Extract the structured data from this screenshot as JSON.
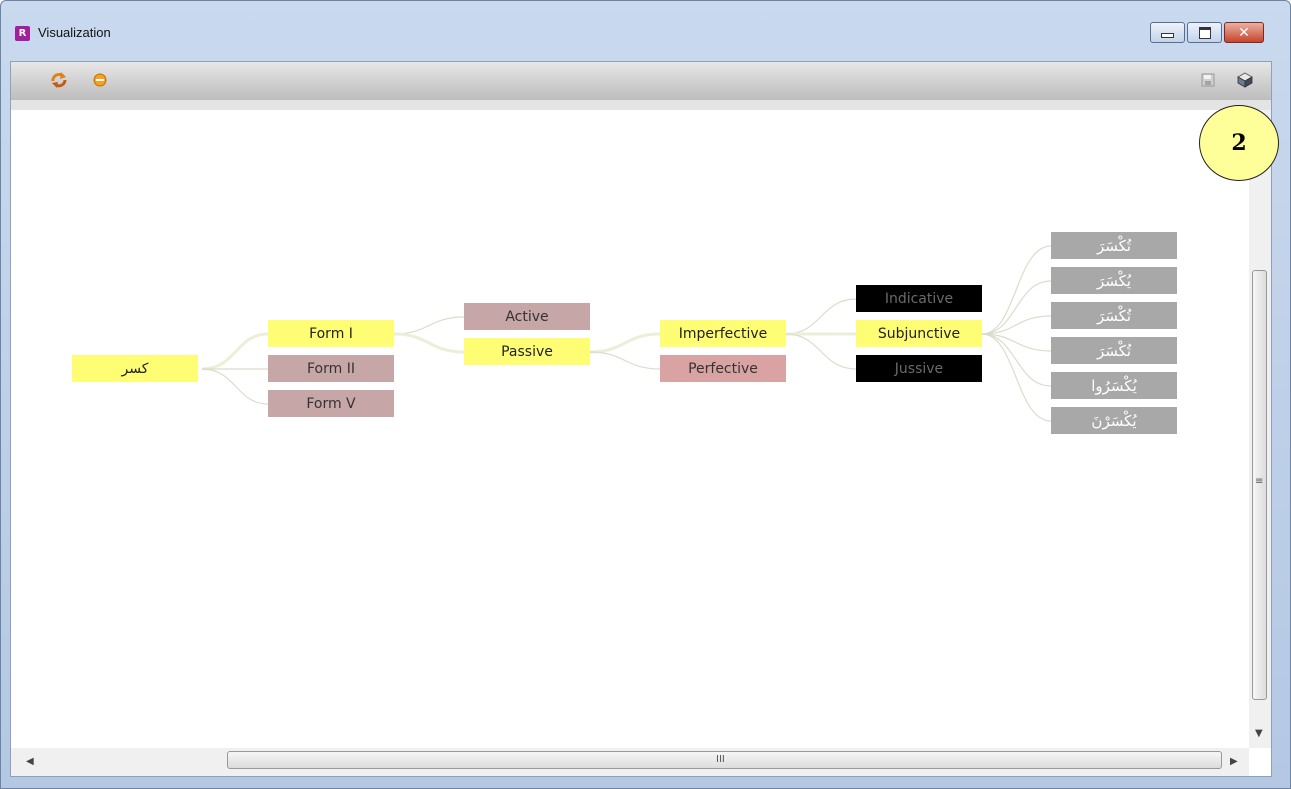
{
  "window": {
    "title": "Visualization"
  },
  "icons": {
    "app": "R-app-icon",
    "refresh": "refresh-arrows-icon",
    "stop": "orange-circle-icon",
    "save": "save-disk-icon",
    "export": "3d-box-icon"
  },
  "tree": {
    "root": "كسر",
    "forms": [
      "Form I",
      "Form II",
      "Form V"
    ],
    "voices": [
      "Active",
      "Passive"
    ],
    "aspects": [
      "Imperfective",
      "Perfective"
    ],
    "moods": [
      "Indicative",
      "Subjunctive",
      "Jussive"
    ],
    "conjugations": [
      "تُكْسَرَ",
      "يُكْسَرَ",
      "تُكْسَرَ",
      "تُكْسَرَ",
      "يُكْسَرُوا",
      "يُكْسَرْنَ"
    ]
  },
  "scrollbar": {
    "h_grip": "III",
    "v_grip": "≡"
  },
  "callout": {
    "label": "2"
  },
  "colors": {
    "selected": "#fffd74",
    "alternate": "#c6a6a6",
    "perfective": "#d9a3a3",
    "disabled": "#000000",
    "leaf": "#a8a8a8",
    "edge": "#dcdccc"
  }
}
